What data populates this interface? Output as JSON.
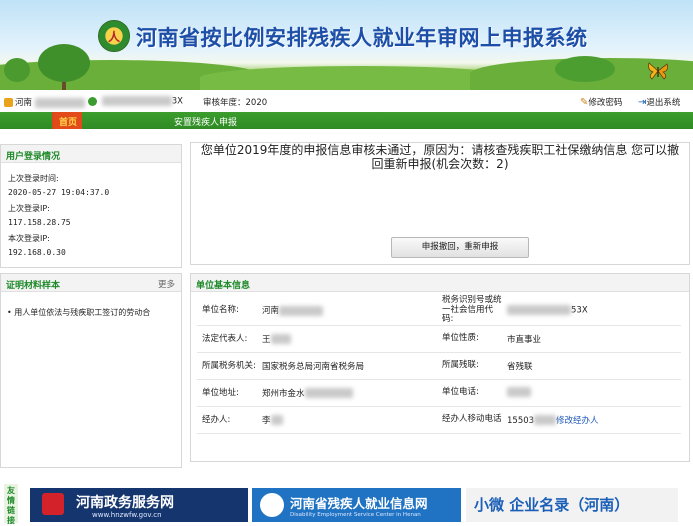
{
  "app": {
    "title": "河南省按比例安排残疾人就业年审网上申报系统"
  },
  "infobar": {
    "user_prefix": "河南",
    "code_suffix": "3X",
    "review_year": "审核年度：2020",
    "change_password": "修改密码",
    "logout": "退出系统"
  },
  "nav": {
    "items": [
      {
        "label": "首页"
      },
      {
        "label": "安置残疾人申报"
      }
    ]
  },
  "login": {
    "title": "用户登录情况",
    "last_time_label": "上次登录时间:",
    "last_time": "2020-05-27 19:04:37.0",
    "last_ip_label": "上次登录IP:",
    "last_ip": "117.158.28.75",
    "this_ip_label": "本次登录IP:",
    "this_ip": "192.168.0.30"
  },
  "sample": {
    "title": "证明材料样本",
    "more": "更多",
    "items": [
      {
        "label": "• 用人单位依法与残疾职工签订的劳动合"
      }
    ]
  },
  "message": {
    "text": "您单位2019年度的申报信息审核未通过，原因为：请核查残疾职工社保缴纳信息 您可以撤回重新申报(机会次数：2)",
    "button": "申报撤回，重新申报"
  },
  "unit": {
    "title": "单位基本信息",
    "rows": [
      {
        "k1": "单位名称:",
        "v1": "河南",
        "k2": "税务识别号或统一社会信用代码:",
        "v2": "53X"
      },
      {
        "k1": "法定代表人:",
        "v1": "王",
        "k2": "单位性质:",
        "v2": "市直事业"
      },
      {
        "k1": "所属税务机关:",
        "v1": "国家税务总局河南省税务局",
        "k2": "所属残联:",
        "v2": "省残联"
      },
      {
        "k1": "单位地址:",
        "v1": "郑州市金水",
        "k2": "单位电话:",
        "v2": ""
      },
      {
        "k1": "经办人:",
        "v1": "李",
        "k2": "经办人移动电话",
        "v2": "15503"
      }
    ],
    "edit_agent": "修改经办人"
  },
  "links": {
    "label": "友情链接",
    "banners": [
      {
        "name": "河南政务服务网",
        "sub": "www.hnzwfw.gov.cn"
      },
      {
        "name": "河南省残疾人就业信息网",
        "sub": "Disability Employment Service Center in Henan"
      },
      {
        "name": "小微 企业名录（河南）",
        "sub": ""
      }
    ]
  }
}
